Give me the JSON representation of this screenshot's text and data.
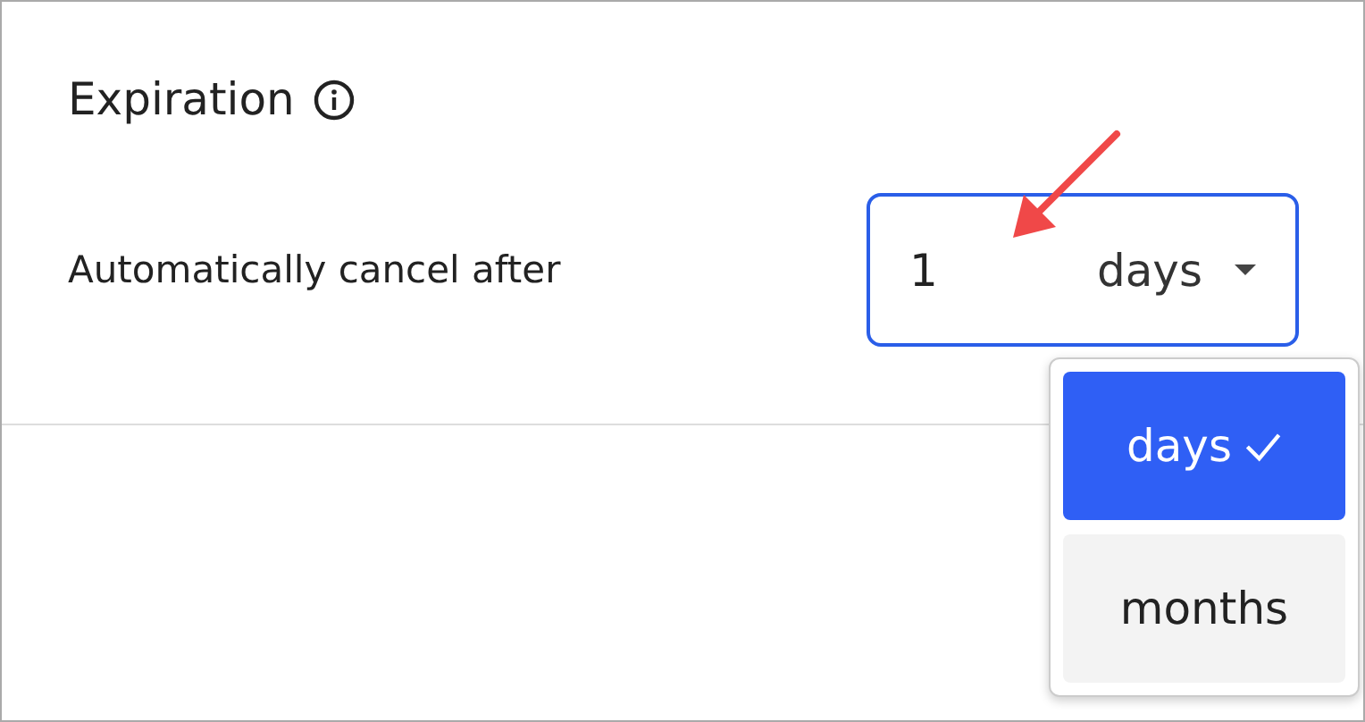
{
  "section": {
    "title": "Expiration"
  },
  "setting": {
    "label": "Automatically cancel after",
    "value": "1",
    "unit": "days"
  },
  "menu": {
    "items": [
      {
        "label": "days",
        "selected": true
      },
      {
        "label": "months",
        "selected": false
      }
    ]
  }
}
